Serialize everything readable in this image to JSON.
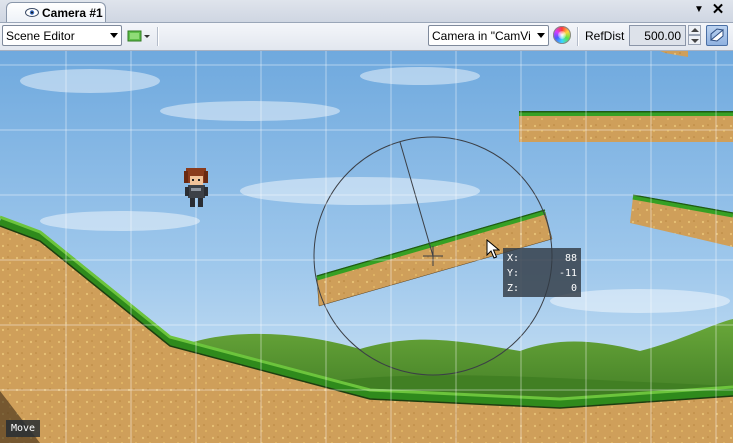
{
  "tab": {
    "title": "Camera #1",
    "icon": "eye-icon"
  },
  "window_controls": {
    "menu_glyph": "▼",
    "close_glyph": "✕"
  },
  "toolbar": {
    "mode_select": {
      "value": "Scene Editor"
    },
    "camera_select": {
      "value": "Camera in \"CamVi"
    },
    "refdist": {
      "label": "RefDist",
      "value": "500.00"
    }
  },
  "viewport": {
    "gizmo_readout": {
      "x_label": "X:",
      "x_value": "88",
      "y_label": "Y:",
      "y_value": "-11",
      "z_label": "Z:",
      "z_value": "0"
    },
    "tool_mode_label": "Move"
  },
  "colors": {
    "sky_top": "#6fa9de",
    "sky_bottom": "#cde3f4",
    "grass": "#3c9a22",
    "dirt": "#cf9f5a",
    "hills": "#4f8a2a"
  }
}
